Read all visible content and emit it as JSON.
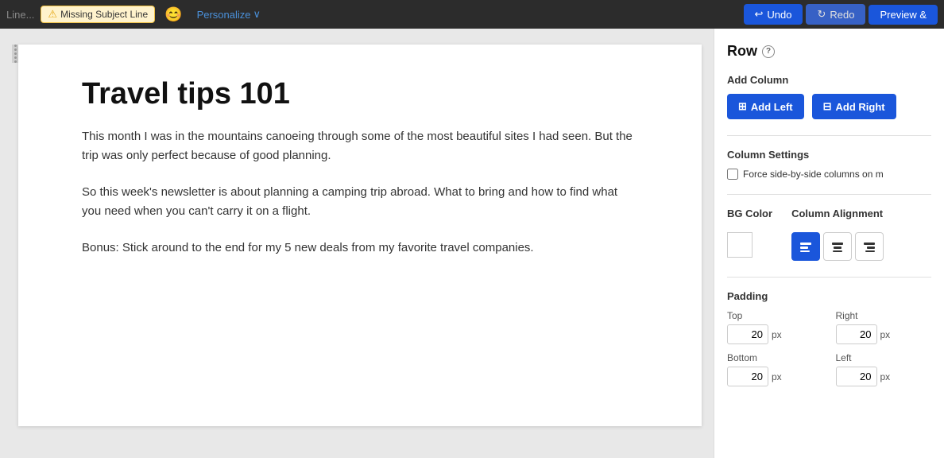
{
  "toolbar": {
    "subject_placeholder": "Line...",
    "missing_subject_label": "Missing Subject Line",
    "emoji_icon": "😊",
    "personalize_label": "Personalize",
    "personalize_chevron": "∨",
    "undo_label": "Undo",
    "redo_label": "Redo",
    "preview_label": "Preview &"
  },
  "email_content": {
    "title": "Travel tips 101",
    "paragraph1": "This month I was in the mountains canoeing through some of the most beautiful sites I had seen. But the trip was only perfect because of good planning.",
    "paragraph2": "So this week's newsletter is about planning a camping trip abroad. What to bring and how to find what you need when you can't carry it on a flight.",
    "paragraph3": "Bonus: Stick around to the end for my 5 new deals from my favorite travel companies."
  },
  "right_panel": {
    "section_title": "Row",
    "help_icon": "?",
    "add_column_label": "Add Column",
    "add_left_label": "Add Left",
    "add_right_label": "Add Right",
    "column_settings_label": "Column Settings",
    "force_side_by_side_label": "Force side-by-side columns on m",
    "bg_color_label": "BG Color",
    "column_alignment_label": "Column Alignment",
    "padding_label": "Padding",
    "padding_top_label": "Top",
    "padding_right_label": "Right",
    "padding_bottom_label": "Bottom",
    "padding_left_label": "Left",
    "padding_top_value": "20",
    "padding_right_value": "20",
    "padding_bottom_value": "20",
    "padding_left_value": "20",
    "px": "px"
  }
}
